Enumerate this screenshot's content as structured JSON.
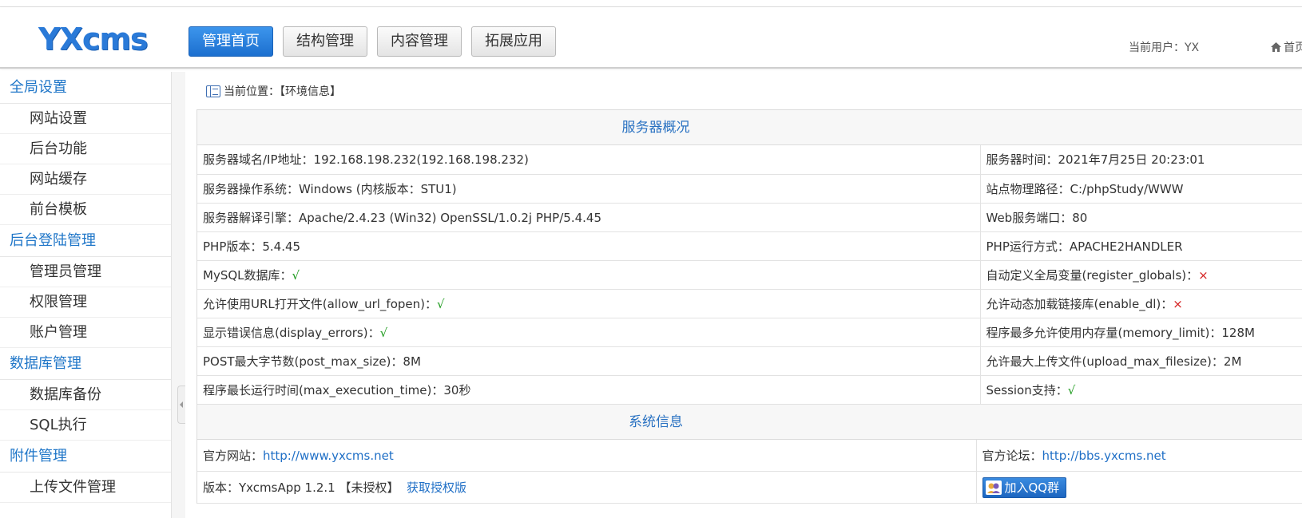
{
  "header": {
    "logo": "YXcms",
    "nav": [
      {
        "label": "管理首页",
        "active": true
      },
      {
        "label": "结构管理",
        "active": false
      },
      {
        "label": "内容管理",
        "active": false
      },
      {
        "label": "拓展应用",
        "active": false
      }
    ],
    "current_user": "当前用户：YX",
    "home_label": "首页"
  },
  "sidebar": {
    "groups": [
      {
        "title": "全局设置",
        "items": [
          "网站设置",
          "后台功能",
          "网站缓存",
          "前台模板"
        ]
      },
      {
        "title": "后台登陆管理",
        "items": [
          "管理员管理",
          "权限管理",
          "账户管理"
        ]
      },
      {
        "title": "数据库管理",
        "items": [
          "数据库备份",
          "SQL执行"
        ]
      },
      {
        "title": "附件管理",
        "items": [
          "上传文件管理"
        ]
      }
    ]
  },
  "breadcrumb": "当前位置：【环境信息】",
  "server": {
    "title": "服务器概况",
    "rows": [
      [
        {
          "label": "服务器域名/IP地址：",
          "value": "192.168.198.232(192.168.198.232)",
          "status": ""
        },
        {
          "label": "服务器时间：",
          "value": "2021年7月25日 20:23:01",
          "status": ""
        }
      ],
      [
        {
          "label": "服务器操作系统：",
          "value": "Windows (内核版本：STU1)",
          "status": ""
        },
        {
          "label": "站点物理路径：",
          "value": "C:/phpStudy/WWW",
          "status": ""
        }
      ],
      [
        {
          "label": "服务器解译引擎：",
          "value": "Apache/2.4.23 (Win32) OpenSSL/1.0.2j PHP/5.4.45",
          "status": ""
        },
        {
          "label": "Web服务端口：",
          "value": "80",
          "status": ""
        }
      ],
      [
        {
          "label": "PHP版本：",
          "value": "5.4.45",
          "status": ""
        },
        {
          "label": "PHP运行方式：",
          "value": "APACHE2HANDLER",
          "status": ""
        }
      ],
      [
        {
          "label": "MySQL数据库：",
          "value": "√",
          "status": "ok"
        },
        {
          "label": "自动定义全局变量(register_globals)：",
          "value": "×",
          "status": "no"
        }
      ],
      [
        {
          "label": "允许使用URL打开文件(allow_url_fopen)：",
          "value": "√",
          "status": "ok"
        },
        {
          "label": "允许动态加载链接库(enable_dl)：",
          "value": "×",
          "status": "no"
        }
      ],
      [
        {
          "label": "显示错误信息(display_errors)：",
          "value": "√",
          "status": "ok"
        },
        {
          "label": "程序最多允许使用内存量(memory_limit)：",
          "value": "128M",
          "status": ""
        }
      ],
      [
        {
          "label": "POST最大字节数(post_max_size)：",
          "value": "8M",
          "status": ""
        },
        {
          "label": "允许最大上传文件(upload_max_filesize)：",
          "value": "2M",
          "status": ""
        }
      ],
      [
        {
          "label": "程序最长运行时间(max_execution_time)：",
          "value": "30秒",
          "status": ""
        },
        {
          "label": "Session支持：",
          "value": "√",
          "status": "ok"
        }
      ]
    ]
  },
  "system": {
    "title": "系统信息",
    "official_site_label": "官方网站：",
    "official_site_url": "http://www.yxcms.net",
    "forum_label": "官方论坛：",
    "forum_url": "http://bbs.yxcms.net",
    "version_label": "版本：",
    "version_value": "YxcmsApp 1.2.1 【未授权】",
    "get_license": "获取授权版",
    "qq_button": "加入QQ群"
  },
  "colors": {
    "accent": "#1f76c8",
    "ok": "#1b9a1b",
    "error": "#d42020"
  }
}
